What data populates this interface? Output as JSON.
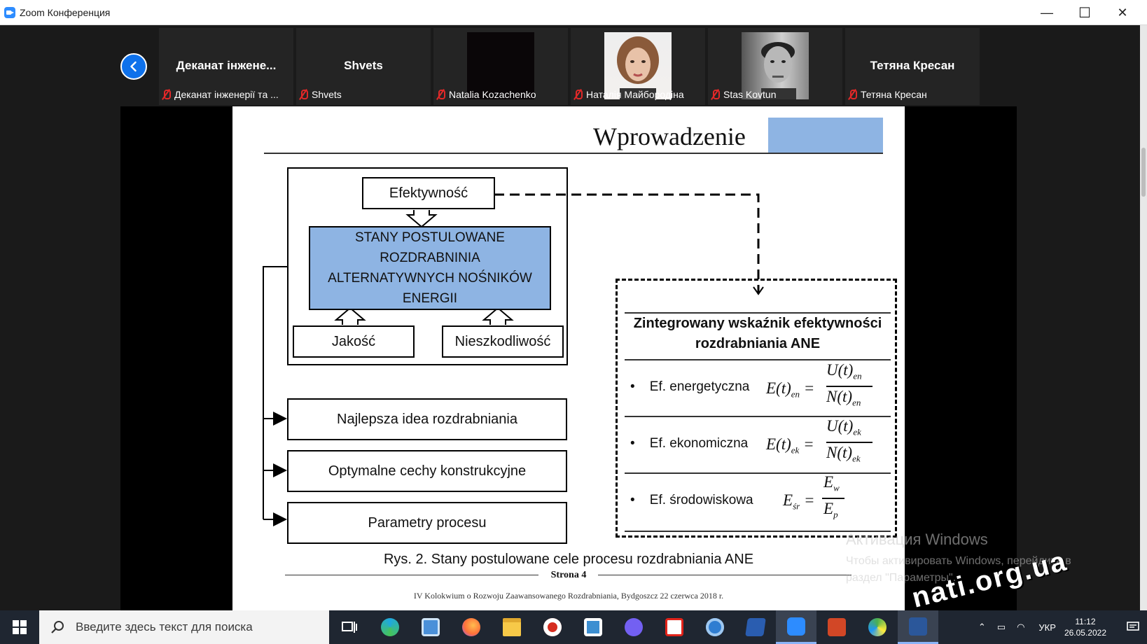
{
  "window": {
    "title": "Zoom Конференция",
    "minimize": "—",
    "maximize": "☐",
    "close": "✕"
  },
  "participants": [
    {
      "name": "Деканат інжене...",
      "label": "Деканат інженерії та ...",
      "muted": true,
      "video": "none"
    },
    {
      "name": "Shvets",
      "label": "Shvets",
      "muted": true,
      "video": "none"
    },
    {
      "name": "",
      "label": "Natalia Kozachenko",
      "muted": true,
      "video": "dark"
    },
    {
      "name": "",
      "label": "Наталія Майбородіна",
      "muted": true,
      "video": "woman"
    },
    {
      "name": "",
      "label": "Stas Kovtun",
      "muted": true,
      "video": "man"
    },
    {
      "name": "Тетяна Кресан",
      "label": "Тетяна Кресан",
      "muted": true,
      "video": "none"
    }
  ],
  "slide": {
    "title": "Wprowadzenie",
    "diagram": {
      "efektywnosc": "Efektywność",
      "stany": [
        "STANY POSTULOWANE",
        "ROZDRABNINIA",
        "ALTERNATYWNYCH NOŚNIKÓW",
        "ENERGII"
      ],
      "jakosc": "Jakość",
      "nieszkodliwosc": "Nieszkodliwość",
      "idea": "Najlepsza idea rozdrabniania",
      "cechy": "Optymalne cechy konstrukcyjne",
      "parametry": "Parametry procesu"
    },
    "panel": {
      "title_line1": "Zintegrowany wskaźnik efektywności",
      "title_line2": "rozdrabniania ANE",
      "items": [
        {
          "label": "Ef. energetyczna",
          "lhs": "E(t)",
          "lhs_sub": "en",
          "num": "U(t)",
          "num_sub": "en",
          "den": "N(t)",
          "den_sub": "en"
        },
        {
          "label": "Ef. ekonomiczna",
          "lhs": "E(t)",
          "lhs_sub": "ek",
          "num": "U(t)",
          "num_sub": "ek",
          "den": "N(t)",
          "den_sub": "ek"
        },
        {
          "label": "Ef. środowiskowa",
          "lhs": "E",
          "lhs_sub": "śr",
          "num": "E",
          "num_sub": "w",
          "den": "E",
          "den_sub": "p"
        }
      ]
    },
    "caption": "Rys. 2. Stany postulowane  cele procesu  rozdrabniania ANE",
    "page": "Strona 4",
    "footer": "IV Kolokwium o Rozwoju Zaawansowanego Rozdrabniania, Bydgoszcz 22 czerwca 2018 r."
  },
  "activation": {
    "title": "Активация Windows",
    "line1": "Чтобы активировать Windows, перейдите в",
    "line2": "раздел \"Параметры\"."
  },
  "watermark": "nati.org.ua",
  "taskbar": {
    "search_placeholder": "Введите здесь текст для поиска",
    "language": "УКР",
    "time": "11:12",
    "date": "26.05.2022",
    "apps": [
      {
        "name": "task-view",
        "color": "#ffffff"
      },
      {
        "name": "edge",
        "color": "#1fa8e0"
      },
      {
        "name": "remote-desktop",
        "color": "#4a90d9"
      },
      {
        "name": "firefox",
        "color": "#ff7139"
      },
      {
        "name": "file-explorer",
        "color": "#f7c948"
      },
      {
        "name": "any-video",
        "color": "#d62d20"
      },
      {
        "name": "windows-app",
        "color": "#3d8fd1"
      },
      {
        "name": "viber",
        "color": "#7360f2"
      },
      {
        "name": "acrobat",
        "color": "#e2231a"
      },
      {
        "name": "browser-k",
        "color": "#2f7dd1"
      },
      {
        "name": "screen-app",
        "color": "#2a5db0"
      },
      {
        "name": "zoom",
        "color": "#2d8cff"
      },
      {
        "name": "powerpoint",
        "color": "#d24726"
      },
      {
        "name": "paint-app",
        "color": "#4caf50"
      },
      {
        "name": "word",
        "color": "#2b579a"
      }
    ]
  }
}
